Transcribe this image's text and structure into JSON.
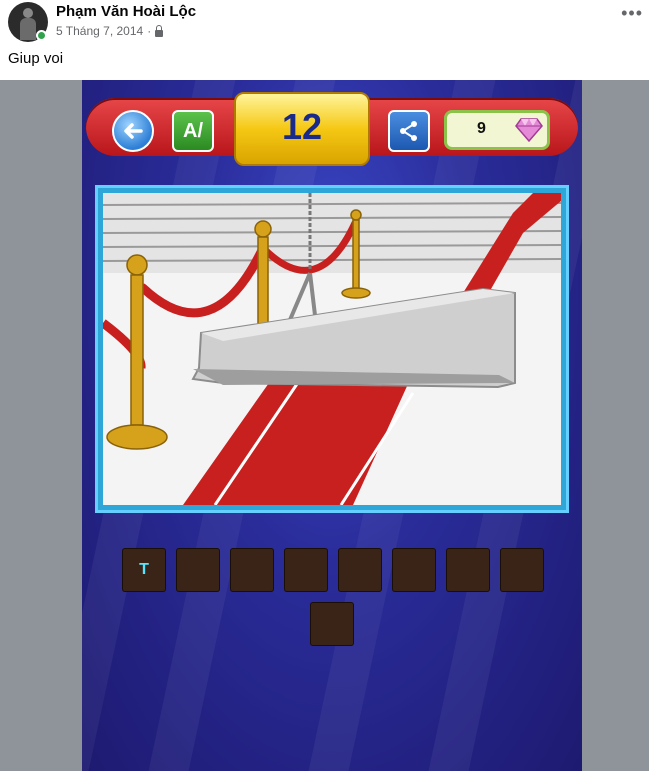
{
  "post": {
    "author_name": "Phạm Văn Hoài Lộc",
    "date": "5 Tháng 7, 2014",
    "separator": "·",
    "text": "Giup voi",
    "privacy_icon": "lock-icon",
    "more_icon": "more-icon",
    "more_glyph": "•••"
  },
  "game": {
    "level": "12",
    "hint_label": "A/",
    "gem_count": "9",
    "icons": {
      "back": "back-arrow-icon",
      "share": "share-icon",
      "gem": "gem-icon"
    },
    "picture_description": "",
    "answer_rows": [
      [
        "T",
        "",
        "",
        "",
        "",
        "",
        "",
        ""
      ],
      [
        ""
      ]
    ],
    "colors": {
      "bar_red": "#d0272b",
      "level_gold": "#f5c814",
      "slot_text": "#55e6ff"
    }
  }
}
